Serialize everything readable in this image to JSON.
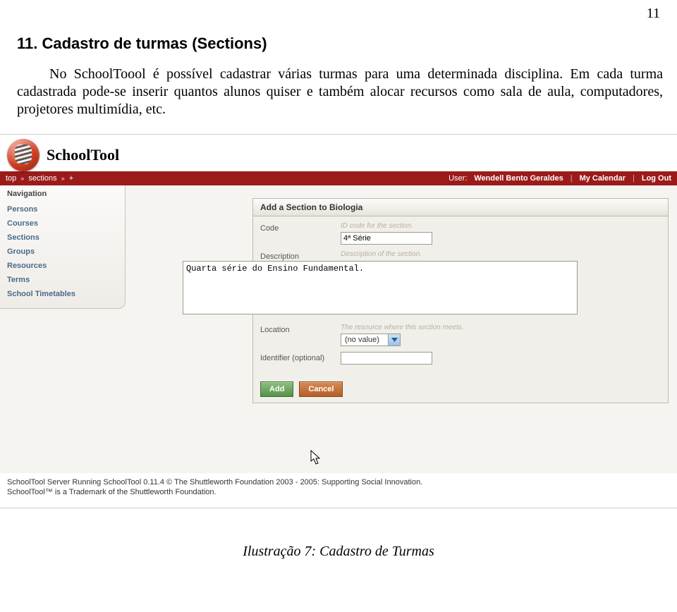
{
  "page_number": "11",
  "doc": {
    "heading": "11. Cadastro de turmas (Sections)",
    "paragraph": "No SchoolToool é possível cadastrar várias turmas para uma determinada disciplina. Em cada turma cadastrada pode-se inserir quantos alunos quiser e também alocar recursos como sala de aula, computadores, projetores multimídia, etc."
  },
  "app": {
    "title": "SchoolTool",
    "breadcrumb": {
      "top": "top",
      "sections": "sections",
      "plus": "+"
    },
    "bar": {
      "user_label": "User:",
      "user_name": "Wendell Bento Geraldes",
      "my_calendar": "My Calendar",
      "log_out": "Log Out"
    },
    "nav": {
      "title": "Navigation",
      "items": [
        "Persons",
        "Courses",
        "Sections",
        "Groups",
        "Resources",
        "Terms",
        "School Timetables"
      ]
    },
    "form": {
      "title": "Add a Section to Biologia",
      "code": {
        "label": "Code",
        "hint": "ID code for the section.",
        "value": "4ª Série"
      },
      "description": {
        "label": "Description",
        "hint": "Description of the section.",
        "value": "Quarta série do Ensino Fundamental."
      },
      "location": {
        "label": "Location",
        "hint": "The resource where this section meets.",
        "value": "(no value)"
      },
      "identifier": {
        "label": "Identifier (optional)",
        "value": ""
      },
      "buttons": {
        "add": "Add",
        "cancel": "Cancel"
      }
    },
    "footer": {
      "line1": "SchoolTool Server Running SchoolTool 0.11.4 © The Shuttleworth Foundation 2003 - 2005: Supporting Social Innovation.",
      "line2": "SchoolTool™ is a Trademark of the Shuttleworth Foundation."
    }
  },
  "caption": "Ilustração 7: Cadastro de Turmas"
}
